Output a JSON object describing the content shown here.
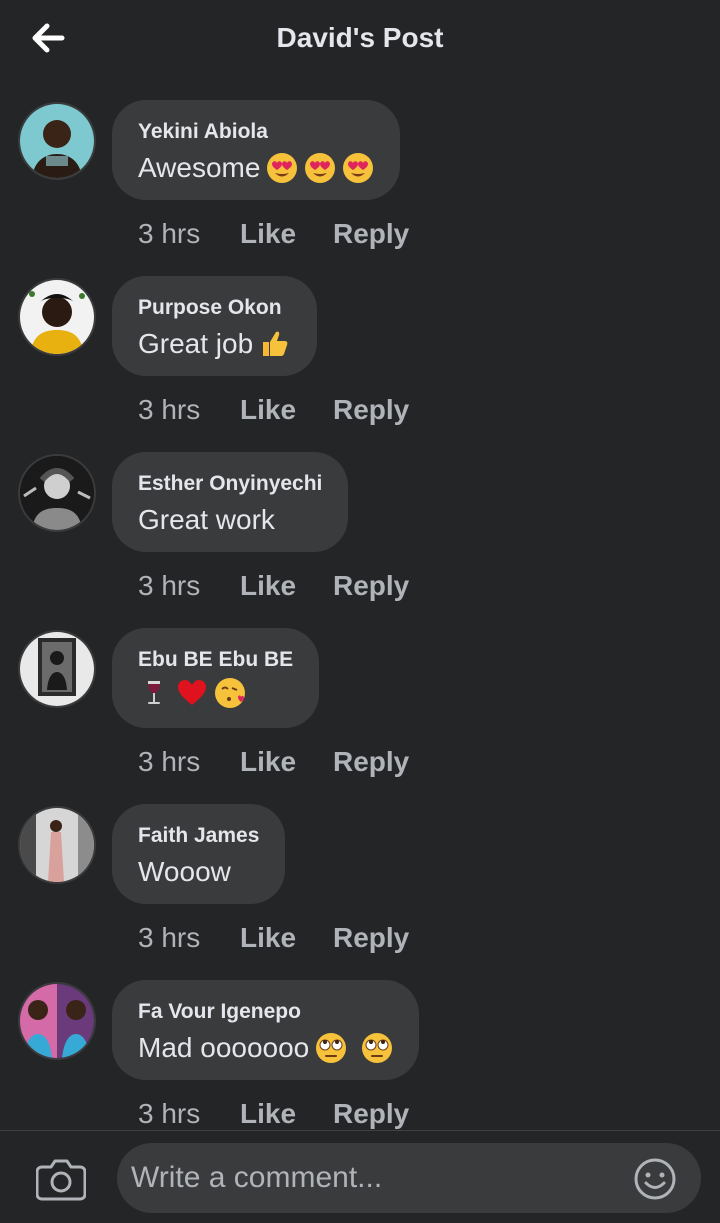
{
  "header": {
    "title": "David's Post",
    "back_icon": "back-arrow-icon"
  },
  "comments": [
    {
      "author": "Yekini Abiola",
      "text": "Awesome",
      "emojis": [
        "heart-eyes",
        "heart-eyes",
        "heart-eyes"
      ],
      "time": "3 hrs",
      "like": "Like",
      "reply": "Reply"
    },
    {
      "author": "Purpose Okon",
      "text": "Great job",
      "emojis": [
        "thumbs-up"
      ],
      "time": "3 hrs",
      "like": "Like",
      "reply": "Reply"
    },
    {
      "author": "Esther Onyinyechi",
      "text": "Great work",
      "emojis": [],
      "time": "3 hrs",
      "like": "Like",
      "reply": "Reply"
    },
    {
      "author": "Ebu BE Ebu BE",
      "text": "",
      "emojis": [
        "wine-glass",
        "red-heart",
        "kissing-face"
      ],
      "time": "3 hrs",
      "like": "Like",
      "reply": "Reply"
    },
    {
      "author": "Faith James",
      "text": "Wooow",
      "emojis": [],
      "time": "3 hrs",
      "like": "Like",
      "reply": "Reply"
    },
    {
      "author": "Fa Vour Igenepo",
      "text": "Mad ooooooo",
      "emojis": [
        "eye-roll",
        "eye-roll"
      ],
      "time": "3 hrs",
      "like": "Like",
      "reply": "Reply"
    }
  ],
  "composer": {
    "placeholder": "Write a comment...",
    "camera_icon": "camera-icon",
    "emoji_icon": "smiley-icon"
  },
  "colors": {
    "background": "#242526",
    "bubble": "#3a3b3c",
    "text": "#e4e6eb",
    "secondary_text": "#b0b3b8"
  }
}
